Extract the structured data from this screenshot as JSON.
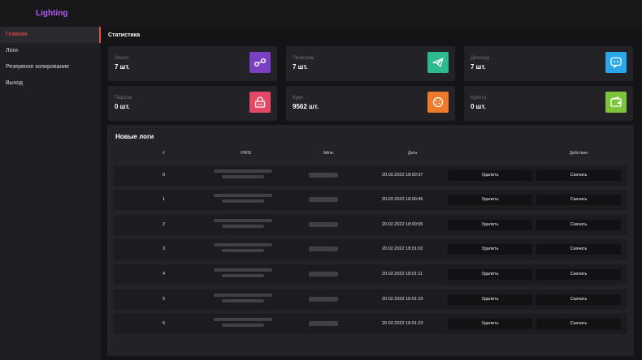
{
  "app": {
    "title": "Lighting"
  },
  "sidebar": {
    "items": [
      {
        "label": "Главная",
        "active": true
      },
      {
        "label": "Логи"
      },
      {
        "label": "Резервное копирование"
      },
      {
        "label": "Выход"
      }
    ]
  },
  "stats": {
    "title": "Статистика",
    "cards": [
      {
        "label": "Steam",
        "value": "7 шт.",
        "icon": "steam-icon",
        "color": "#7b3fc2"
      },
      {
        "label": "Телеграм",
        "value": "7 шт.",
        "icon": "telegram-icon",
        "color": "#2fb98e"
      },
      {
        "label": "Дискорд",
        "value": "7 шт.",
        "icon": "discord-icon",
        "color": "#2aa7e8"
      },
      {
        "label": "Пароли",
        "value": "0 шт.",
        "icon": "password-icon",
        "color": "#e54865"
      },
      {
        "label": "Куки",
        "value": "9562 шт.",
        "icon": "cookie-icon",
        "color": "#ee7a2b"
      },
      {
        "label": "Крипта",
        "value": "0 шт.",
        "icon": "wallet-icon",
        "color": "#7cc43a"
      }
    ]
  },
  "logs": {
    "title": "Новые логи",
    "columns": {
      "num": "#",
      "hwid": "HWID",
      "ip": "Айпи",
      "date": "Дата",
      "action": "Действие:"
    },
    "rows": [
      {
        "num": "0",
        "date": "20.02.2022 18:00:37",
        "delete": "Удалить",
        "download": "Скачать"
      },
      {
        "num": "1",
        "date": "20.02.2022 18:00:46",
        "delete": "Удалить",
        "download": "Скачать"
      },
      {
        "num": "2",
        "date": "20.02.2022 18:00:55",
        "delete": "Удалить",
        "download": "Скачать"
      },
      {
        "num": "3",
        "date": "20.02.2022 18:01:02",
        "delete": "Удалить",
        "download": "Скачать"
      },
      {
        "num": "4",
        "date": "20.02.2022 18:01:11",
        "delete": "Удалить",
        "download": "Скачать"
      },
      {
        "num": "5",
        "date": "20.02.2022 18:01:19",
        "delete": "Удалить",
        "download": "Скачать"
      },
      {
        "num": "6",
        "date": "20.02.2022 18:01:23",
        "delete": "Удалить",
        "download": "Скачать"
      }
    ]
  }
}
